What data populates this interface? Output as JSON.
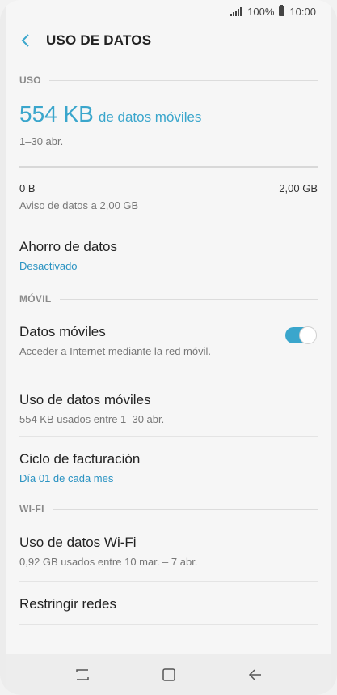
{
  "status_bar": {
    "battery": "100%",
    "time": "10:00"
  },
  "header": {
    "title": "USO DE DATOS"
  },
  "uso_section": {
    "label": "USO",
    "amount": "554 KB",
    "unit_text": "de datos móviles",
    "range": "1–30 abr.",
    "limit_min": "0 B",
    "limit_max": "2,00 GB",
    "warning": "Aviso de datos a 2,00 GB"
  },
  "ahorro": {
    "title": "Ahorro de datos",
    "status": "Desactivado"
  },
  "movil_section": {
    "label": "MÓVIL",
    "datos_moviles": {
      "title": "Datos móviles",
      "subtitle": "Acceder a Internet mediante la red móvil.",
      "enabled": true
    },
    "uso_moviles": {
      "title": "Uso de datos móviles",
      "subtitle": "554 KB usados entre 1–30 abr."
    },
    "ciclo": {
      "title": "Ciclo de facturación",
      "subtitle": "Día 01 de cada mes"
    }
  },
  "wifi_section": {
    "label": "WI-FI",
    "uso_wifi": {
      "title": "Uso de datos Wi-Fi",
      "subtitle": "0,92 GB usados entre 10 mar. – 7 abr."
    },
    "restringir": {
      "title": "Restringir redes"
    }
  },
  "colors": {
    "accent": "#3aa6cc",
    "link": "#2a93c2"
  },
  "icons": [
    "signal-icon",
    "battery-icon",
    "back-arrow-icon",
    "recents-icon",
    "home-icon",
    "nav-back-icon"
  ]
}
